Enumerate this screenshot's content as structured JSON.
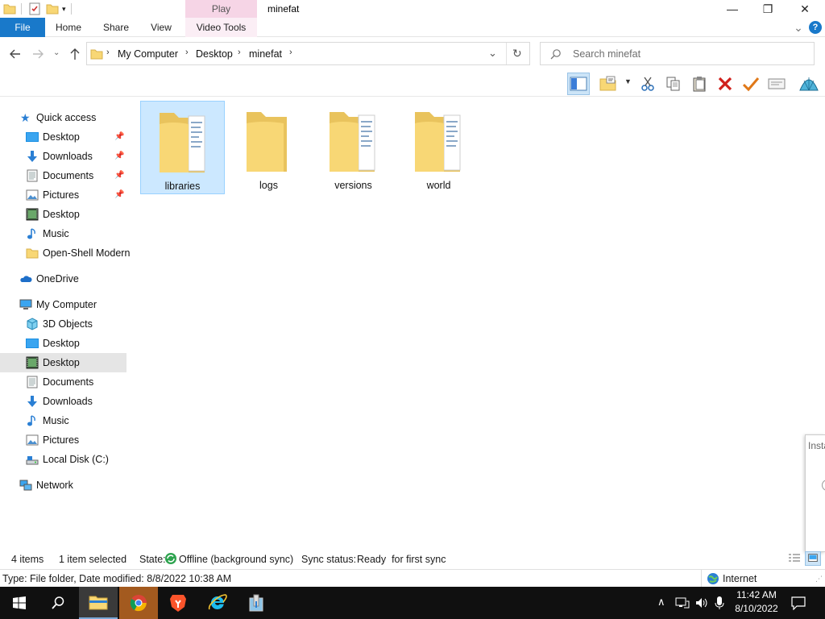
{
  "window": {
    "title": "minefat",
    "contextual_tab_group": "Play",
    "minimize_glyph": "—",
    "maximize_glyph": "❐",
    "close_glyph": "✕"
  },
  "ribbon": {
    "tabs": [
      "File",
      "Home",
      "Share",
      "View",
      "Video Tools"
    ],
    "collapse_glyph": "⌄",
    "help_glyph": "?"
  },
  "address": {
    "breadcrumb": [
      "My Computer",
      "Desktop",
      "minefat"
    ],
    "separator": "›",
    "refresh_glyph": "↻",
    "dropdown_glyph": "⌄"
  },
  "search": {
    "placeholder": "Search minefat"
  },
  "nav_pane": {
    "quick_access": {
      "label": "Quick access"
    },
    "quick_access_items": [
      {
        "label": "Desktop",
        "pinned": true,
        "icon": "desktop-icon"
      },
      {
        "label": "Downloads",
        "pinned": true,
        "icon": "downloads-icon"
      },
      {
        "label": "Documents",
        "pinned": true,
        "icon": "documents-icon"
      },
      {
        "label": "Pictures",
        "pinned": true,
        "icon": "pictures-icon"
      },
      {
        "label": "Desktop",
        "pinned": false,
        "icon": "desktop-video-icon"
      },
      {
        "label": "Music",
        "pinned": false,
        "icon": "music-icon"
      },
      {
        "label": "Open-Shell Modern",
        "pinned": false,
        "icon": "folder-icon"
      }
    ],
    "onedrive": {
      "label": "OneDrive"
    },
    "my_computer": {
      "label": "My Computer"
    },
    "my_computer_items": [
      {
        "label": "3D Objects",
        "icon": "3d-objects-icon"
      },
      {
        "label": "Desktop",
        "icon": "desktop-icon"
      },
      {
        "label": "Desktop",
        "icon": "desktop-video-icon",
        "selected": true
      },
      {
        "label": "Documents",
        "icon": "documents-icon"
      },
      {
        "label": "Downloads",
        "icon": "downloads-icon"
      },
      {
        "label": "Music",
        "icon": "music-icon"
      },
      {
        "label": "Pictures",
        "icon": "pictures-icon"
      },
      {
        "label": "Local Disk (C:)",
        "icon": "local-disk-icon"
      }
    ],
    "network": {
      "label": "Network"
    }
  },
  "content": {
    "items": [
      {
        "name": "libraries",
        "type": "folder-with-files",
        "selected": true
      },
      {
        "name": "logs",
        "type": "folder-empty",
        "selected": false
      },
      {
        "name": "versions",
        "type": "folder-with-files",
        "selected": false
      },
      {
        "name": "world",
        "type": "folder-with-files",
        "selected": false
      }
    ]
  },
  "status": {
    "item_count": "4 items",
    "selection": "1 item selected",
    "state_label": "State:",
    "state_value": "Offline (background sync)",
    "sync_label": "Sync status:",
    "sync_value": "Ready  for first sync"
  },
  "info_bar": {
    "details": "Type: File folder, Date modified: 8/8/2022 10:38 AM",
    "zone": "Internet"
  },
  "popup": {
    "text": "Insta"
  },
  "taskbar": {
    "apps": [
      "start-icon",
      "search-icon",
      "file-explorer-icon",
      "chrome-icon",
      "brave-icon",
      "internet-explorer-icon",
      "installer-icon"
    ],
    "clock_time": "11:42 AM",
    "clock_date": "8/10/2022"
  },
  "colors": {
    "accent": "#1979ca",
    "selection_bg": "#cce8ff",
    "selection_border": "#99d1ff",
    "context_tab": "#f6d5e6",
    "taskbar": "#101010",
    "folder_yellow": "#f8d775"
  }
}
